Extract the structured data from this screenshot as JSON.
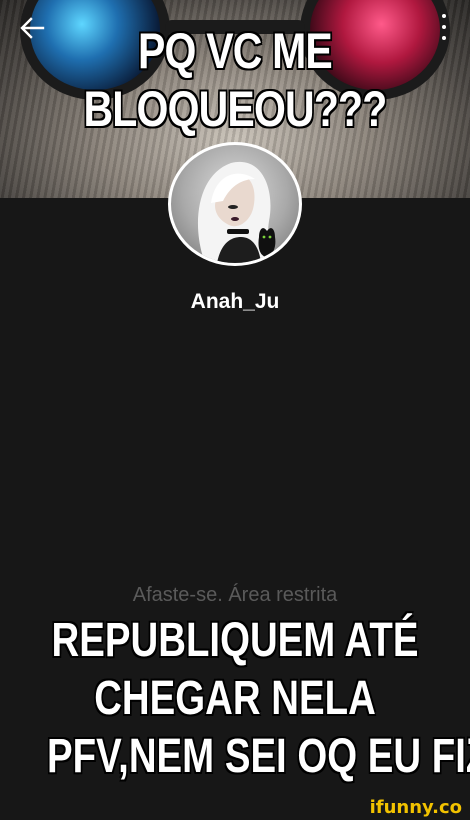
{
  "banner": {
    "meme_line_1": "PQ VC ME",
    "meme_line_2": "BLOQUEOU???"
  },
  "nav": {
    "back_icon": "arrow-left-icon",
    "menu_icon": "more-vertical-icon"
  },
  "profile": {
    "username": "Anah_Ju",
    "status": "Afaste-se. Área restrita"
  },
  "caption": {
    "line_1": "REPUBLIQUEM ATÉ",
    "line_2": "CHEGAR NELA",
    "line_3": "PFV,NEM SEI OQ EU FIZ"
  },
  "watermark": "ifunny.co",
  "colors": {
    "background": "#171717",
    "watermark": "#f2c200",
    "status_text": "#5a5a5a"
  }
}
